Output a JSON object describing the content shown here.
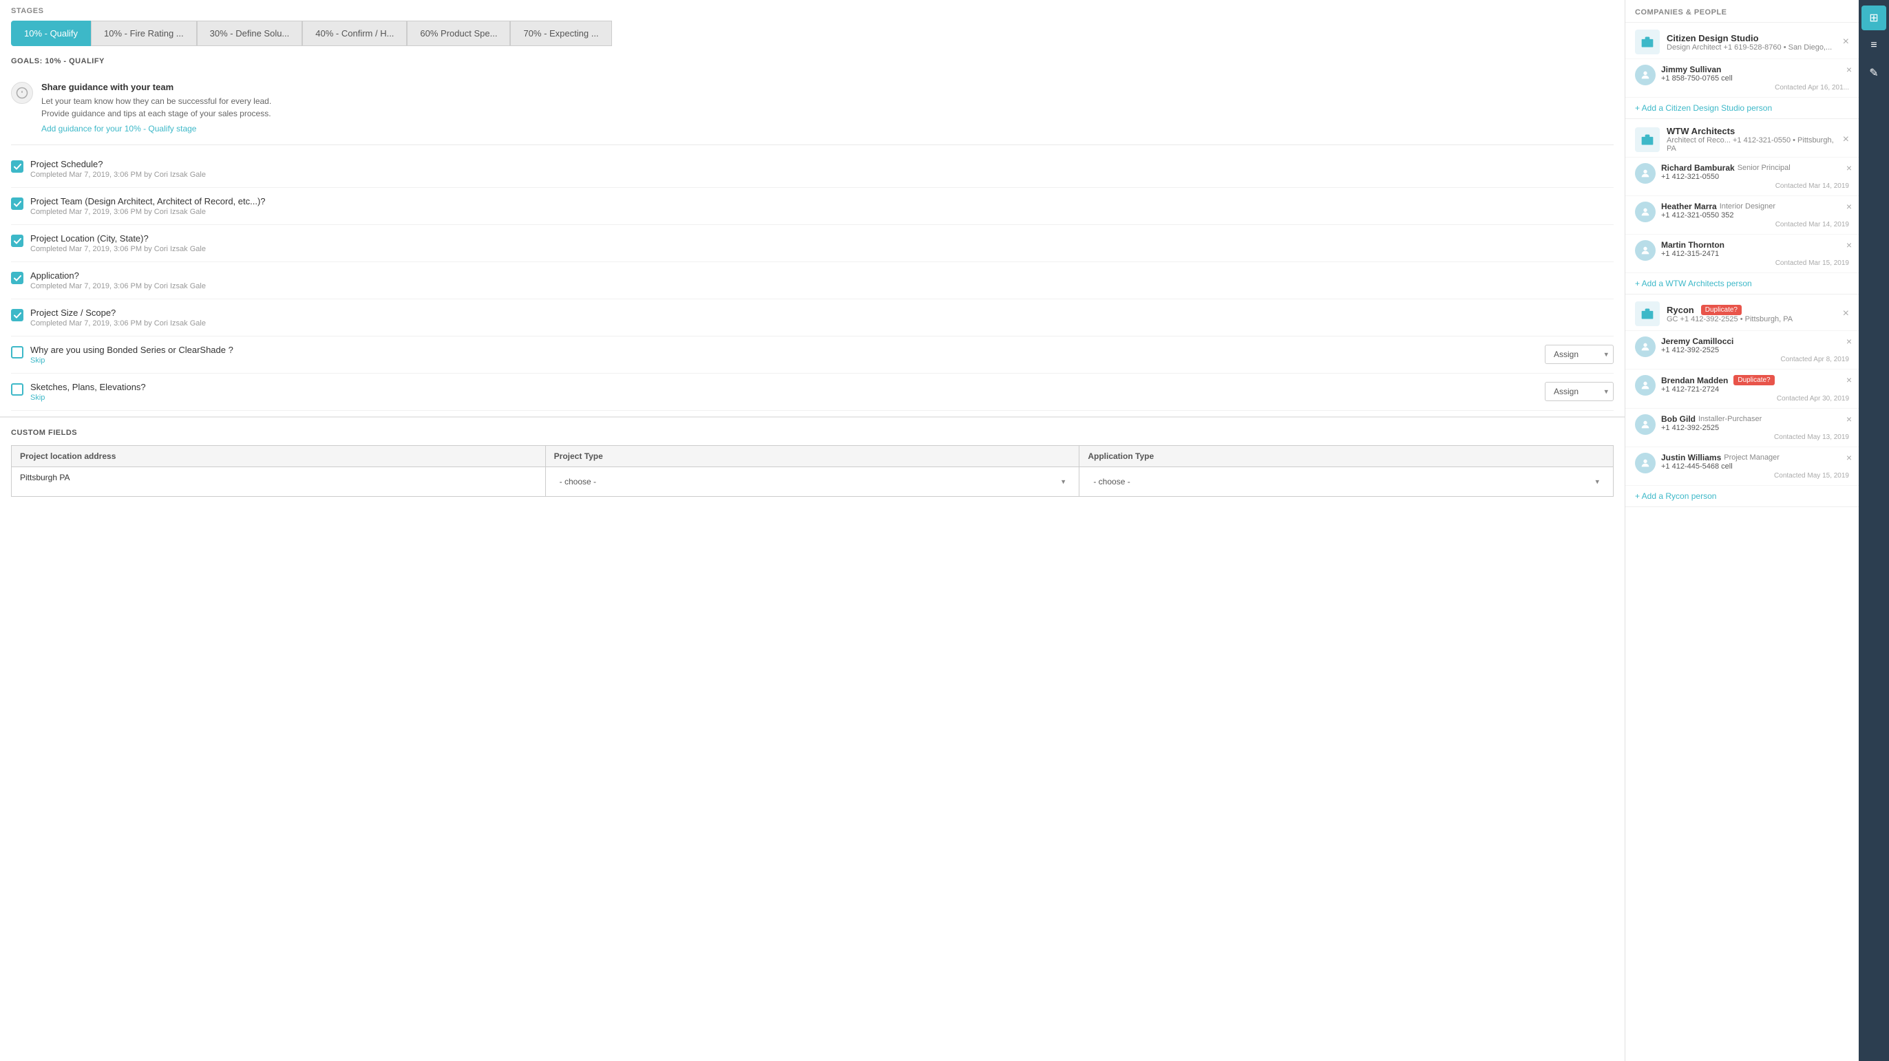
{
  "stages": {
    "label": "STAGES",
    "tabs": [
      {
        "id": "qualify",
        "label": "10% - Qualify",
        "active": true
      },
      {
        "id": "fire-rating",
        "label": "10% - Fire Rating ...",
        "active": false
      },
      {
        "id": "define-solu",
        "label": "30% - Define Solu...",
        "active": false
      },
      {
        "id": "confirm-h",
        "label": "40% - Confirm / H...",
        "active": false
      },
      {
        "id": "product-spe",
        "label": "60% Product Spe...",
        "active": false
      },
      {
        "id": "expecting",
        "label": "70% - Expecting ...",
        "active": false
      }
    ]
  },
  "goals": {
    "label": "GOALS: 10% - QUALIFY",
    "guidance": {
      "title": "Share guidance with your team",
      "desc1": "Let your team know how they can be successful for every lead.",
      "desc2": "Provide guidance and tips at each stage of your sales process.",
      "link": "Add guidance for your 10% - Qualify stage"
    }
  },
  "checklist": {
    "items": [
      {
        "id": "project-schedule",
        "label": "Project Schedule?",
        "checked": true,
        "meta": "Completed Mar 7, 2019, 3:06 PM by Cori Izsak Gale",
        "has_assign": false
      },
      {
        "id": "project-team",
        "label": "Project Team (Design Architect, Architect of Record, etc...)?",
        "checked": true,
        "meta": "Completed Mar 7, 2019, 3:06 PM by Cori Izsak Gale",
        "has_assign": false
      },
      {
        "id": "project-location",
        "label": "Project Location (City, State)?",
        "checked": true,
        "meta": "Completed Mar 7, 2019, 3:06 PM by Cori Izsak Gale",
        "has_assign": false
      },
      {
        "id": "application",
        "label": "Application?",
        "checked": true,
        "meta": "Completed Mar 7, 2019, 3:06 PM by Cori Izsak Gale",
        "has_assign": false
      },
      {
        "id": "project-size",
        "label": "Project Size / Scope?",
        "checked": true,
        "meta": "Completed Mar 7, 2019, 3:06 PM by Cori Izsak Gale",
        "has_assign": false
      },
      {
        "id": "bonded-series",
        "label": "Why are you using Bonded Series or ClearShade ?",
        "checked": false,
        "meta": "",
        "has_assign": true,
        "skip_label": "Skip",
        "assign_label": "Assign"
      },
      {
        "id": "sketches",
        "label": "Sketches, Plans, Elevations?",
        "checked": false,
        "meta": "",
        "has_assign": true,
        "skip_label": "Skip",
        "assign_label": "Assign"
      }
    ]
  },
  "custom_fields": {
    "label": "CUSTOM FIELDS",
    "fields": [
      {
        "id": "project-location-address",
        "header": "Project location address",
        "type": "text",
        "value": "Pittsburgh PA"
      },
      {
        "id": "project-type",
        "header": "Project Type",
        "type": "select",
        "placeholder": "- choose -",
        "options": [
          "- choose -"
        ]
      },
      {
        "id": "application-type",
        "header": "Application Type",
        "type": "select",
        "placeholder": "- choose -",
        "options": [
          "- choose -"
        ]
      }
    ]
  },
  "sidebar": {
    "title": "COMPANIES & PEOPLE",
    "companies": [
      {
        "id": "citizen-design",
        "name": "Citizen Design Studio",
        "role": "Design Architect",
        "phone": "+1 619-528-8760",
        "location": "San Diego,...",
        "duplicate": false,
        "persons": [
          {
            "id": "jimmy-sullivan",
            "name": "Jimmy Sullivan",
            "role": "",
            "phone": "+1 858-750-0765",
            "phone_type": "cell",
            "contacted": "Contacted Apr 16, 201..."
          }
        ],
        "add_person_label": "+ Add a Citizen Design Studio person"
      },
      {
        "id": "wtw-architects",
        "name": "WTW Architects",
        "role": "Architect of Reco...",
        "phone": "+1 412-321-0550",
        "location": "Pittsburgh, PA",
        "duplicate": false,
        "persons": [
          {
            "id": "richard-bamburak",
            "name": "Richard Bamburak",
            "role": "Senior Principal",
            "phone": "+1 412-321-0550",
            "phone_type": "",
            "contacted": "Contacted Mar 14, 2019"
          },
          {
            "id": "heather-marra",
            "name": "Heather Marra",
            "role": "Interior Designer",
            "phone": "+1 412-321-0550",
            "phone_ext": "352",
            "contacted": "Contacted Mar 14, 2019"
          },
          {
            "id": "martin-thornton",
            "name": "Martin Thornton",
            "role": "",
            "phone": "+1 412-315-2471",
            "phone_type": "",
            "contacted": "Contacted Mar 15, 2019"
          }
        ],
        "add_person_label": "+ Add a WTW Architects person"
      },
      {
        "id": "rycon",
        "name": "Rycon",
        "role": "GC",
        "phone": "+1 412-392-2525",
        "location": "Pittsburgh, PA",
        "duplicate": true,
        "duplicate_label": "Duplicate?",
        "persons": [
          {
            "id": "jeremy-camillocci",
            "name": "Jeremy Camillocci",
            "role": "",
            "phone": "+1 412-392-2525",
            "phone_type": "",
            "contacted": "Contacted Apr 8, 2019",
            "duplicate": false
          },
          {
            "id": "brendan-madden",
            "name": "Brendan Madden",
            "role": "",
            "phone": "+1 412-721-2724",
            "phone_type": "",
            "contacted": "Contacted Apr 30, 2019",
            "duplicate": true,
            "duplicate_label": "Duplicate?"
          },
          {
            "id": "bob-gild",
            "name": "Bob Gild",
            "role": "Installer-Purchaser",
            "phone": "+1 412-392-2525",
            "phone_type": "",
            "contacted": "Contacted May 13, 2019"
          },
          {
            "id": "justin-williams",
            "name": "Justin Williams",
            "role": "Project Manager",
            "phone": "+1 412-445-5468",
            "phone_type": "cell",
            "contacted": "Contacted May 15, 2019"
          }
        ],
        "add_person_label": "+ Add a Rycon person"
      }
    ]
  },
  "far_right_icons": [
    {
      "id": "grid-icon",
      "symbol": "⊞",
      "active": true
    },
    {
      "id": "list-icon",
      "symbol": "≡",
      "active": false
    },
    {
      "id": "edit-icon",
      "symbol": "✎",
      "active": false
    }
  ]
}
